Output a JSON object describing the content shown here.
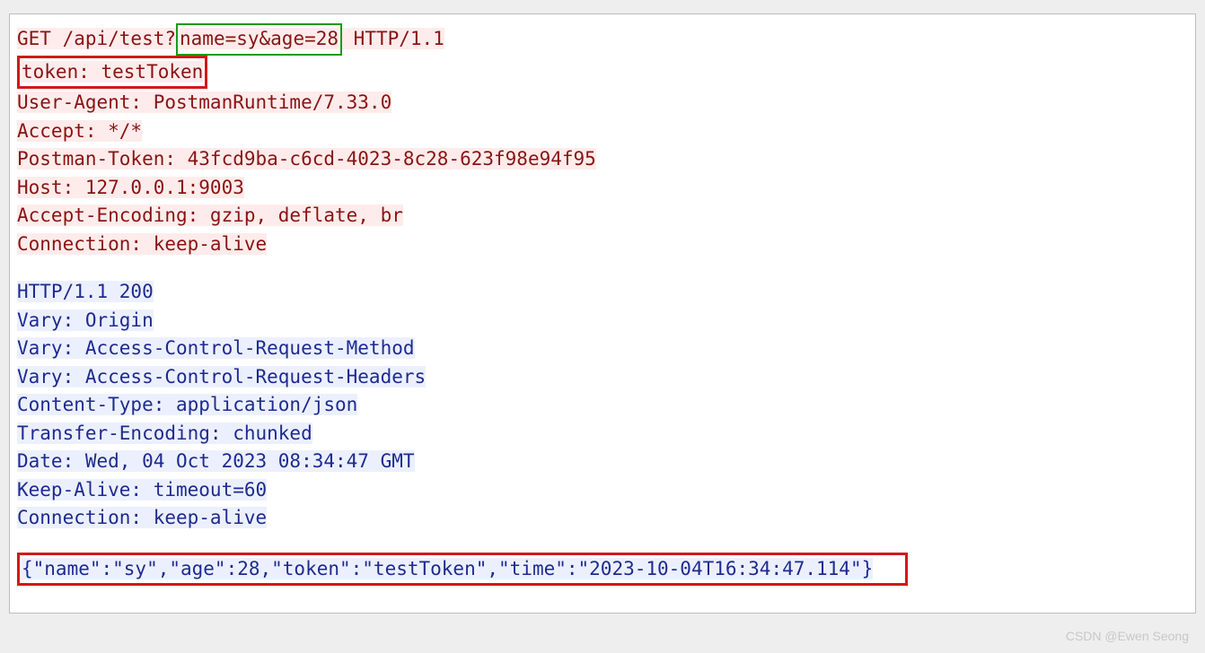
{
  "request": {
    "line1_pre": "GET /api/test?",
    "line1_query": "name=sy&age=28",
    "line1_post": " HTTP/1.1",
    "line2_token": "token: testToken",
    "headers": [
      "User-Agent: PostmanRuntime/7.33.0",
      "Accept: */*",
      "Postman-Token: 43fcd9ba-c6cd-4023-8c28-623f98e94f95",
      "Host: 127.0.0.1:9003",
      "Accept-Encoding: gzip, deflate, br",
      "Connection: keep-alive"
    ]
  },
  "response": {
    "headers": [
      "HTTP/1.1 200",
      "Vary: Origin",
      "Vary: Access-Control-Request-Method",
      "Vary: Access-Control-Request-Headers",
      "Content-Type: application/json",
      "Transfer-Encoding: chunked",
      "Date: Wed, 04 Oct 2023 08:34:47 GMT",
      "Keep-Alive: timeout=60",
      "Connection: keep-alive"
    ],
    "body": "{\"name\":\"sy\",\"age\":28,\"token\":\"testToken\",\"time\":\"2023-10-04T16:34:47.114\"}"
  },
  "watermark": "CSDN @Ewen Seong"
}
